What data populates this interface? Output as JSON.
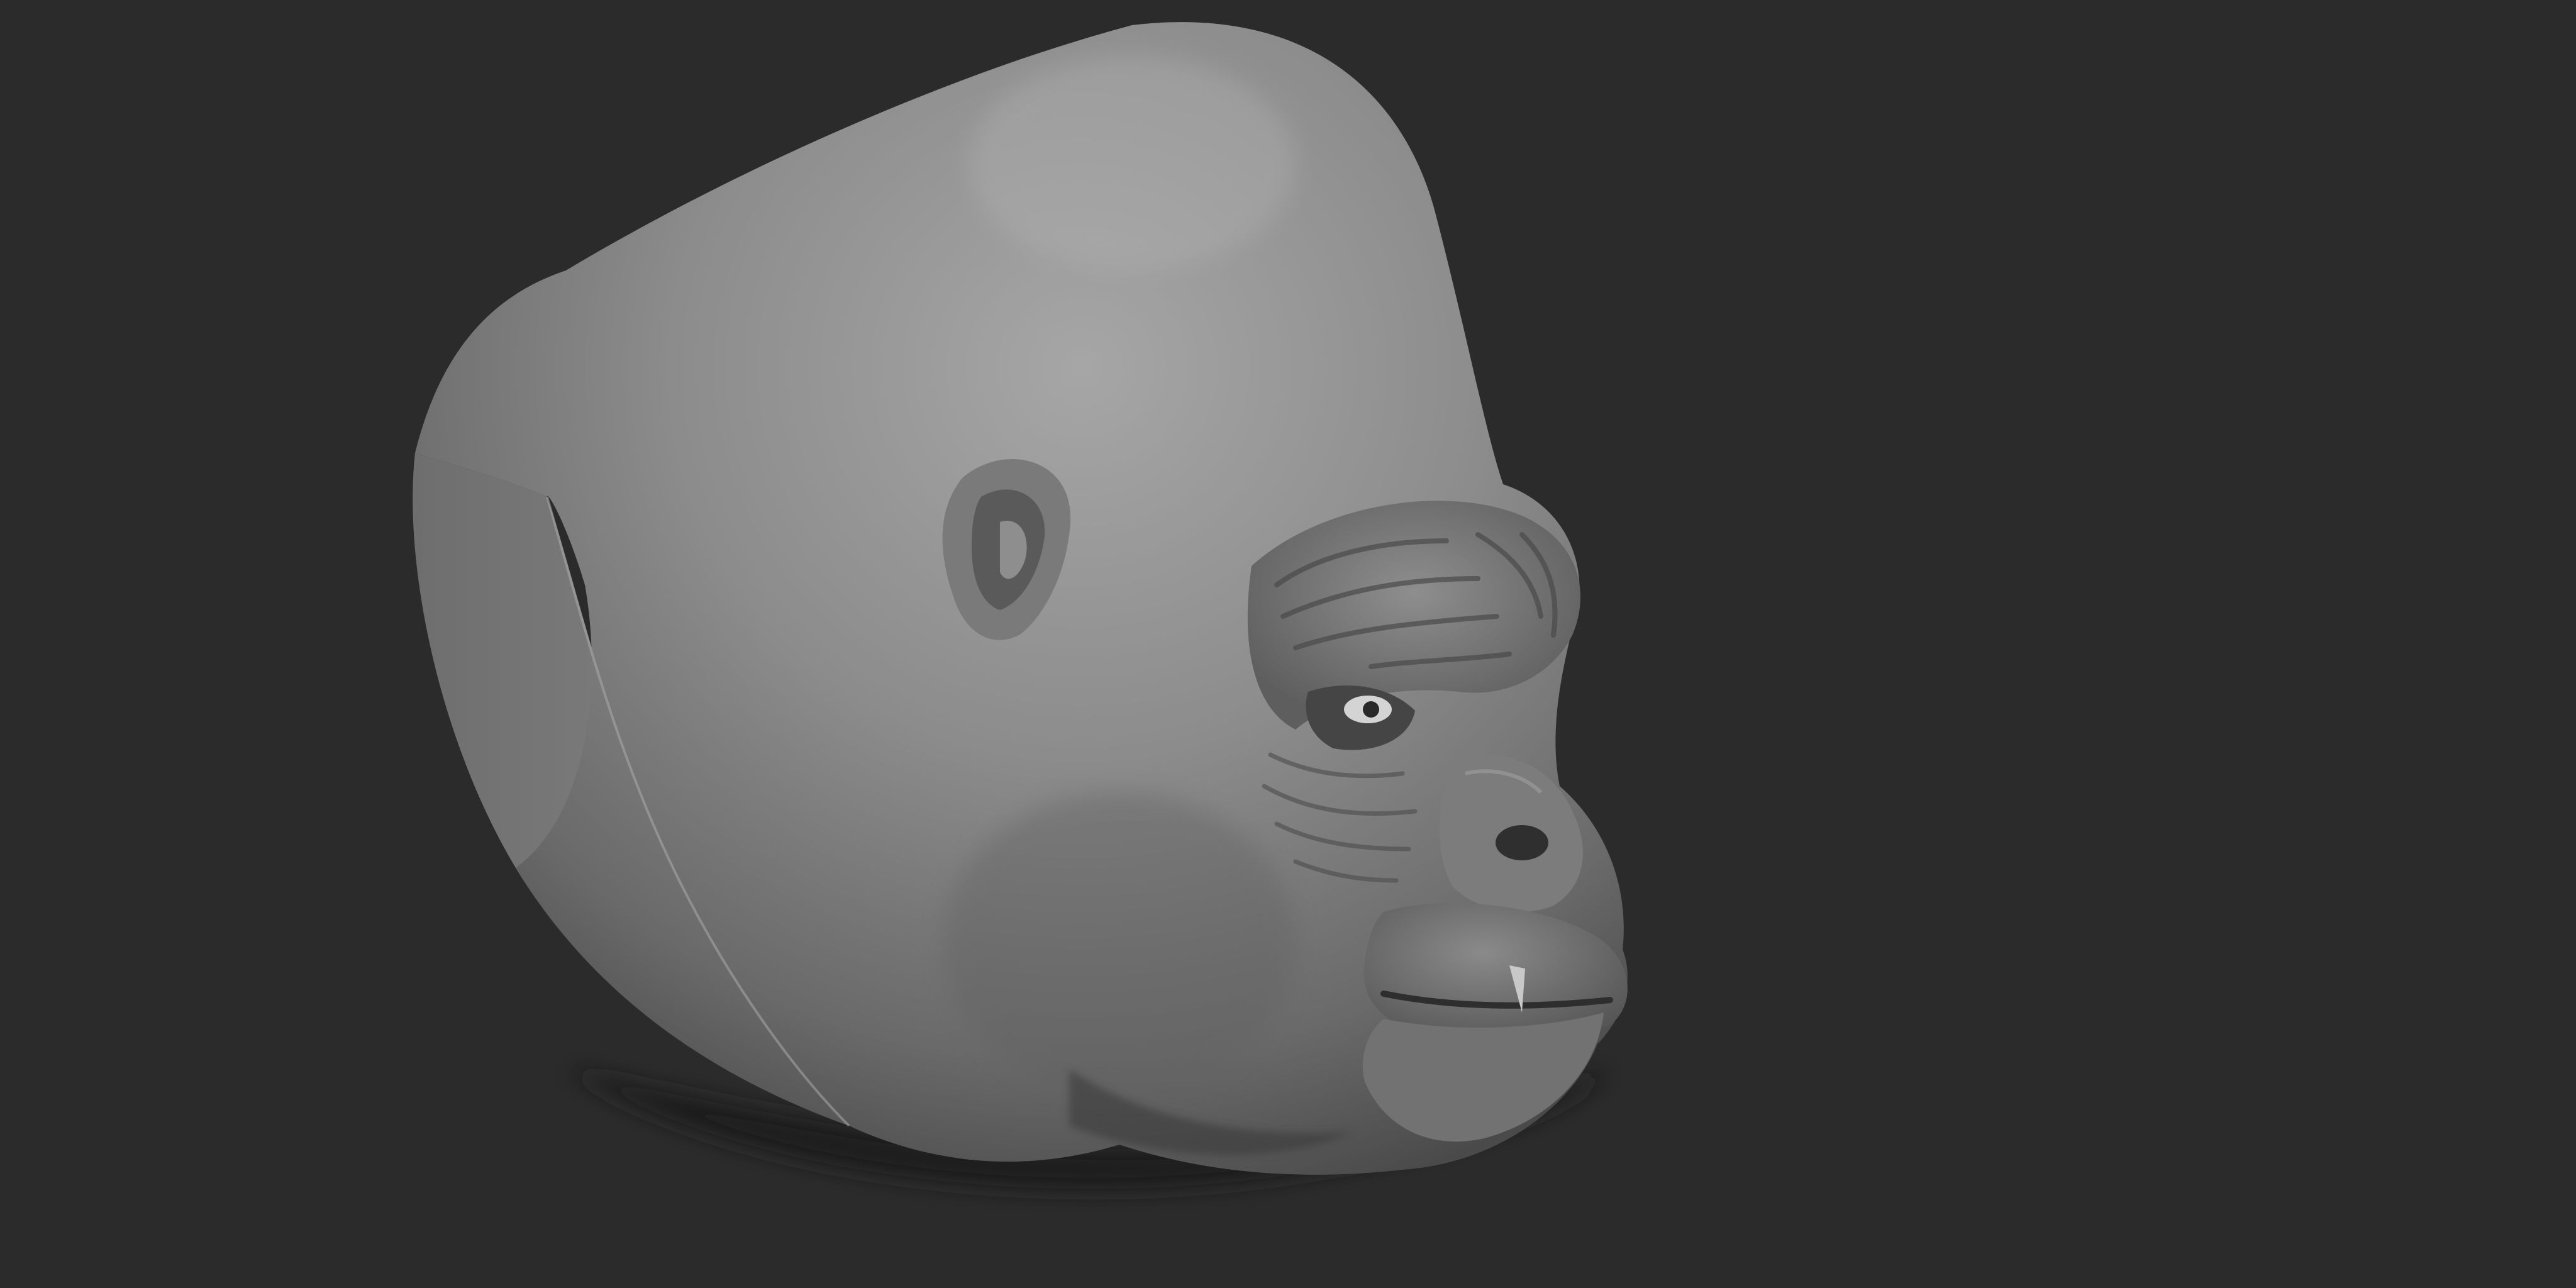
{
  "scene": {
    "subject": "gorilla-head-sculpt",
    "colors": {
      "background": "#2b2b2b",
      "clay_base": "#8a8a8a",
      "clay_highlight": "#a3a3a3",
      "clay_shadow": "#3a3a3a",
      "eye_white": "#d9d9d9",
      "cast_shadow": "#1e1e1e"
    }
  }
}
